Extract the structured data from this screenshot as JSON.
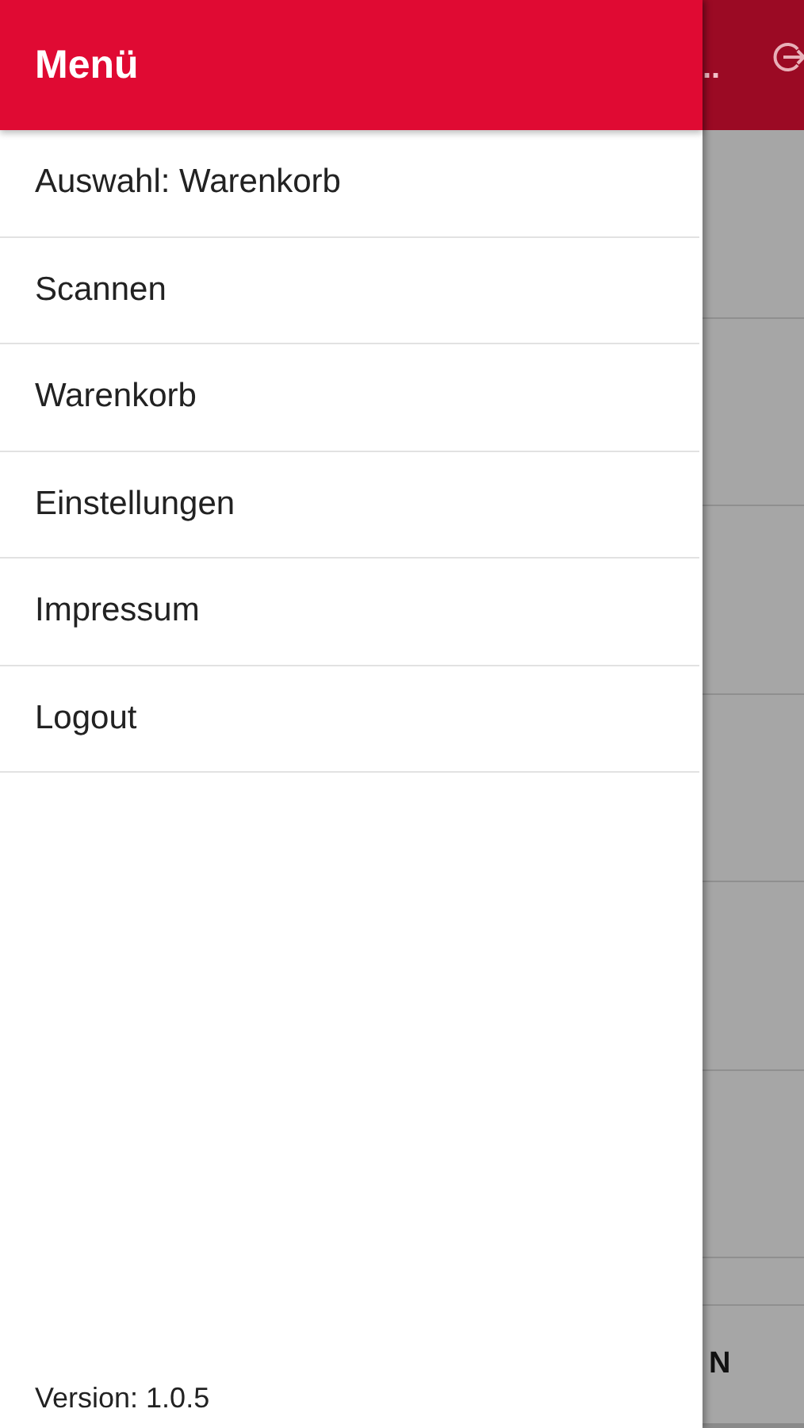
{
  "drawer": {
    "title": "Menü",
    "items": [
      {
        "label": "Auswahl: Warenkorb"
      },
      {
        "label": "Scannen"
      },
      {
        "label": "Warenkorb"
      },
      {
        "label": "Einstellungen"
      },
      {
        "label": "Impressum"
      },
      {
        "label": "Logout"
      }
    ],
    "version": "Version: 1.0.5"
  },
  "background": {
    "title": "..",
    "footer_button": "N"
  }
}
